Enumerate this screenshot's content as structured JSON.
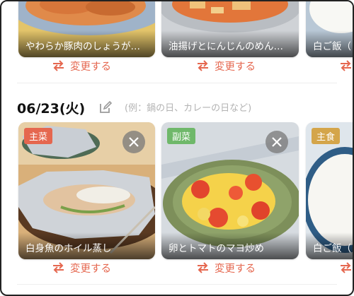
{
  "top_row": {
    "cards": [
      {
        "title": "やわらか豚肉のしょうが…"
      },
      {
        "title": "油揚げとにんじんのめん…"
      },
      {
        "title": "白ご飯（"
      }
    ],
    "change_label": "変更する"
  },
  "day": {
    "date": "06/23(火)",
    "memo_placeholder": "(例：鍋の日、カレーの日など)"
  },
  "bottom_row": {
    "cards": [
      {
        "tag": "主菜",
        "title": "白身魚のホイル蒸し"
      },
      {
        "tag": "副菜",
        "title": "卵とトマトのマヨ炒め"
      },
      {
        "tag": "主食",
        "title": "白ご飯（"
      }
    ],
    "change_label": "変更する"
  },
  "colors": {
    "accent": "#e5674f",
    "tag_main": "#e5674f",
    "tag_side": "#6fb86a",
    "tag_staple": "#d4a54a"
  },
  "icons": [
    "swap-arrows-icon",
    "edit-note-icon",
    "close-icon"
  ]
}
